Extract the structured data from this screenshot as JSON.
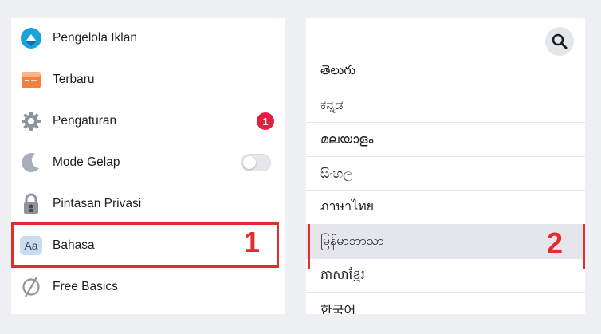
{
  "left_menu": {
    "items": [
      {
        "label": "Pengelola Iklan",
        "icon": "ads-manager-icon"
      },
      {
        "label": "Terbaru",
        "icon": "recent-feed-icon"
      },
      {
        "label": "Pengaturan",
        "icon": "gear-icon",
        "badge": "1"
      },
      {
        "label": "Mode Gelap",
        "icon": "moon-icon",
        "toggle": "off"
      },
      {
        "label": "Pintasan Privasi",
        "icon": "lock-icon"
      },
      {
        "label": "Bahasa",
        "icon": "language-icon",
        "icon_text": "Aa"
      },
      {
        "label": "Free Basics",
        "icon": "free-basics-icon"
      }
    ]
  },
  "language_list": {
    "search_icon": "search-icon",
    "items": [
      {
        "label": "తెలుగు"
      },
      {
        "label": "ಕನ್ನಡ"
      },
      {
        "label": "മലയാളം"
      },
      {
        "label": "සිංහල"
      },
      {
        "label": "ภาษาไทย"
      },
      {
        "label": "မြန်မာဘာသာ",
        "selected": true
      },
      {
        "label": "ភាសាខ្មែរ"
      },
      {
        "label": "한국어"
      }
    ]
  },
  "annotations": {
    "step1": "1",
    "step2": "2",
    "color": "#e62b2b"
  },
  "colors": {
    "badge": "#e41e3f",
    "selected_row": "#e4e6eb",
    "background": "#eef0f3"
  }
}
